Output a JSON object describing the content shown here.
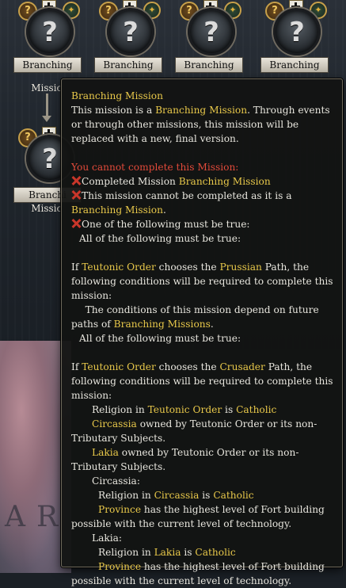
{
  "background": {
    "missions": [
      {
        "label": "Branching",
        "sub": "Missio"
      },
      {
        "label": "Branching",
        "sub": ""
      },
      {
        "label": "Branching",
        "sub": ""
      },
      {
        "label": "Branching",
        "sub": ""
      },
      {
        "label": "Branchi",
        "sub": "Missio"
      }
    ],
    "faded_label": "Branching\nMission",
    "map_text": "AR",
    "question_mark": "?"
  },
  "tooltip": {
    "title": "Branching Mission",
    "desc": {
      "p1": "This mission is a ",
      "link1": "Branching Mission",
      "p2": ". Through events or through other missions, this mission will be replaced with a new, final version."
    },
    "cannot_complete": "You cannot complete this Mission:",
    "req1": {
      "text": "Completed Mission ",
      "link": "Branching Mission"
    },
    "req2": {
      "text": "This mission cannot be completed as it is a ",
      "link": "Branching Mission",
      "end": "."
    },
    "req3": "One of the following must be true:",
    "all_true_1": "All of the following must be true:",
    "prussian": {
      "if": "If ",
      "country": "Teutonic Order",
      "mid": " chooses the ",
      "path": "Prussian",
      "end": " Path, the following conditions will be required to complete this mission:",
      "depend1": "The conditions of this mission depend on future paths of ",
      "depend_link": "Branching Missions",
      "depend_end": ".",
      "all_true": "All of the following must be true:"
    },
    "crusader": {
      "if": "If ",
      "country": "Teutonic Order",
      "mid": " chooses the ",
      "path": "Crusader",
      "end": " Path, the following conditions will be required to complete this mission:",
      "religion": {
        "pre": "Religion in ",
        "country": "Teutonic Order",
        "is": " is ",
        "religion": "Catholic"
      },
      "circassia_owned": {
        "prov": "Circassia",
        "text": " owned by Teutonic Order or its non-Tributary Subjects."
      },
      "lakia_owned": {
        "prov": "Lakia",
        "text": " owned by Teutonic Order or its non-Tributary Subjects."
      },
      "circassia_header": "Circassia:",
      "circassia_religion": {
        "pre": "Religion in ",
        "prov": "Circassia",
        "is": " is ",
        "religion": "Catholic"
      },
      "circassia_fort": {
        "prov": "Province",
        "text": " has the highest level of Fort building possible with the current level of technology."
      },
      "lakia_header": "Lakia:",
      "lakia_religion": {
        "pre": "Religion in ",
        "prov": "Lakia",
        "is": " is ",
        "religion": "Catholic"
      },
      "lakia_fort": {
        "prov": "Province",
        "text": " has the highest level of Fort building possible with the current level of technology."
      }
    }
  },
  "colors": {
    "highlight": "#e8c84a",
    "warning": "#e24a3a",
    "text": "#e8e6de",
    "fail_icon": "#c8362a"
  },
  "icons": [
    "question-mark-icon",
    "teutonic-shield-icon",
    "reward-medal-icon",
    "failed-cross-icon"
  ]
}
